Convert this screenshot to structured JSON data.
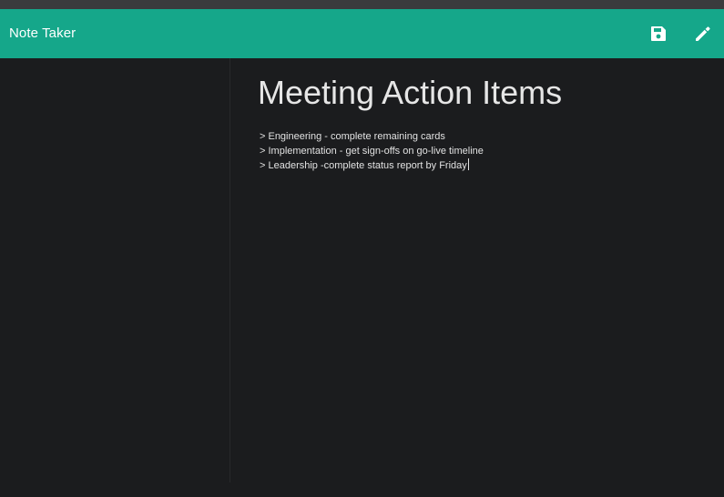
{
  "app": {
    "brand": "Note Taker"
  },
  "toolbar": {
    "save_icon": "floppy-disk-icon",
    "edit_icon": "pencil-icon"
  },
  "note": {
    "title": "Meeting Action Items",
    "lines": [
      "> Engineering - complete remaining cards",
      "> Implementation - get sign-offs on go-live timeline",
      "> Leadership -complete status report by Friday"
    ]
  },
  "colors": {
    "navbar": "#15a78a",
    "background": "#1b1c1e",
    "text": "#e6e6e6"
  }
}
